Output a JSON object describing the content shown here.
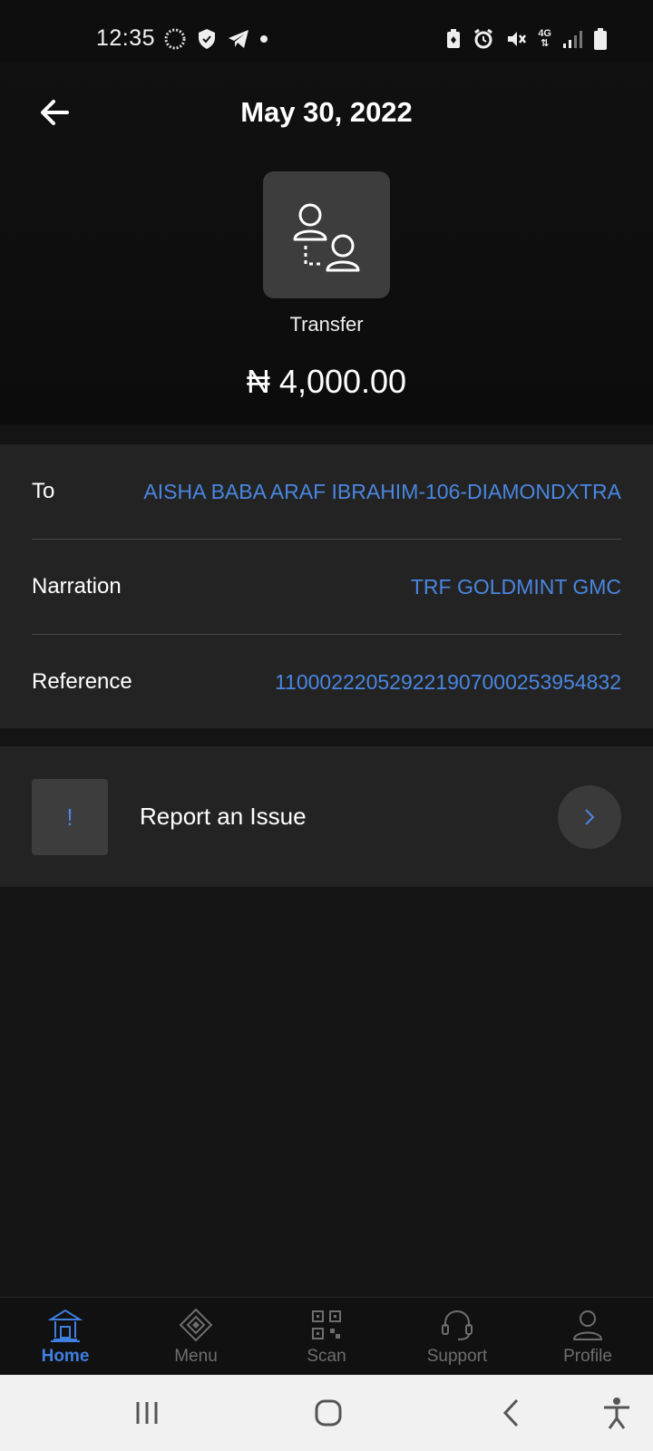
{
  "status_bar": {
    "time": "12:35",
    "network": "4G",
    "icons_left": [
      "sync-icon",
      "shield-icon",
      "telegram-icon",
      "dot-icon"
    ],
    "icons_right": [
      "battery-saver-icon",
      "alarm-icon",
      "mute-icon",
      "network-4g-icon",
      "signal-icon",
      "battery-icon"
    ]
  },
  "header": {
    "title": "May 30, 2022",
    "back_icon": "arrow-left-icon",
    "category_icon": "transfer-users-icon",
    "category_label": "Transfer",
    "amount": "₦ 4,000.00"
  },
  "details": [
    {
      "label": "To",
      "value": "AISHA BABA ARAF IBRAHIM-106-DIAMONDXTRA"
    },
    {
      "label": "Narration",
      "value": "TRF GOLDMINT GMC"
    },
    {
      "label": "Reference",
      "value": "110002220529221907000253954832"
    }
  ],
  "report": {
    "icon_glyph": "!",
    "label": "Report an Issue",
    "arrow_icon": "chevron-right-icon"
  },
  "bottom_nav": [
    {
      "label": "Home",
      "icon": "bank-icon",
      "active": true
    },
    {
      "label": "Menu",
      "icon": "diamond-icon",
      "active": false
    },
    {
      "label": "Scan",
      "icon": "qr-icon",
      "active": false
    },
    {
      "label": "Support",
      "icon": "headset-icon",
      "active": false
    },
    {
      "label": "Profile",
      "icon": "user-icon",
      "active": false
    }
  ],
  "colors": {
    "accent": "#4a86e0",
    "card": "#232323",
    "background": "#141414"
  }
}
